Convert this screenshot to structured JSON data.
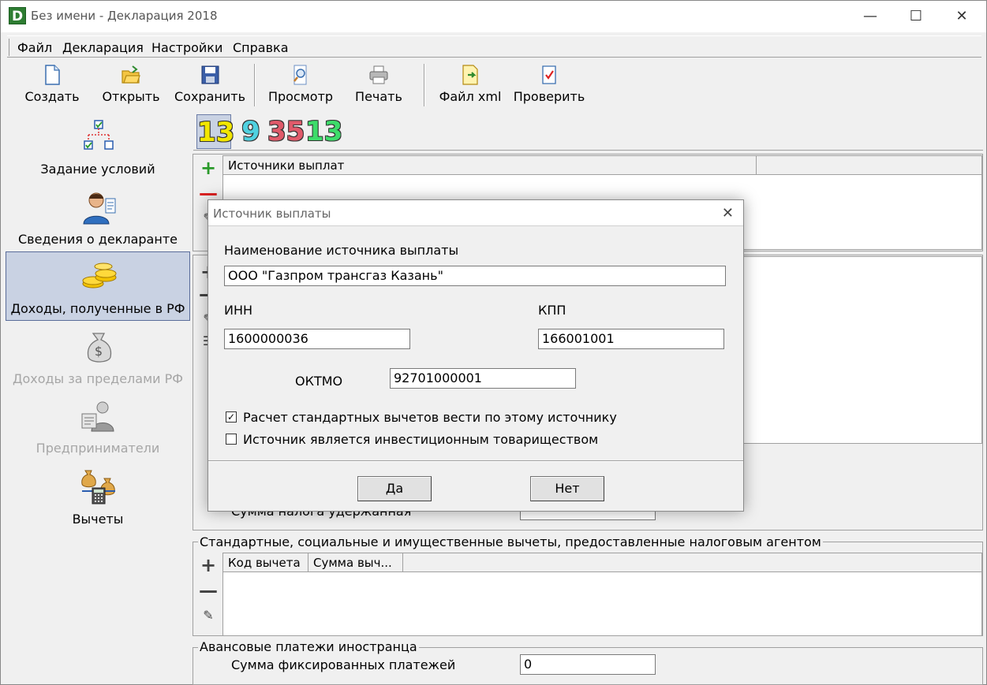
{
  "window": {
    "title": "Без имени - Декларация 2018",
    "app_icon": "D"
  },
  "menu": [
    "Файл",
    "Декларация",
    "Настройки",
    "Справка"
  ],
  "toolbar": {
    "create": "Создать",
    "open": "Открыть",
    "save": "Сохранить",
    "preview": "Просмотр",
    "print": "Печать",
    "xml": "Файл xml",
    "check": "Проверить"
  },
  "nav": [
    {
      "label": "Задание условий",
      "icon": "tree-checkbox-icon",
      "state": "normal"
    },
    {
      "label": "Сведения о декларанте",
      "icon": "person-icon",
      "state": "normal"
    },
    {
      "label": "Доходы, полученные в РФ",
      "icon": "coins-icon",
      "state": "active"
    },
    {
      "label": "Доходы за пределами РФ",
      "icon": "money-bag-icon",
      "state": "disabled"
    },
    {
      "label": "Предприниматели",
      "icon": "businessman-icon",
      "state": "disabled"
    },
    {
      "label": "Вычеты",
      "icon": "calculator-bags-icon",
      "state": "normal"
    }
  ],
  "rate_tabs": [
    {
      "label": "13",
      "color": "#f2e600",
      "selected": true
    },
    {
      "label": "9",
      "color": "#4fd1e0",
      "selected": false
    },
    {
      "label": "35",
      "color": "#e05a6a",
      "selected": false
    },
    {
      "label": "13",
      "color": "#3ddc6a",
      "selected": false
    }
  ],
  "sources_grid": {
    "header": "Источники выплат"
  },
  "tax_withheld_label": "Сумма налога удержанная",
  "deductions_group": {
    "title": "Стандартные, социальные и имущественные вычеты, предоставленные налоговым агентом",
    "col1": "Код вычета",
    "col2": "Сумма выч..."
  },
  "advance_group": {
    "title": "Авансовые платежи иностранца",
    "label": "Сумма фиксированных платежей",
    "value": "0"
  },
  "dialog": {
    "title": "Источник выплаты",
    "name_label": "Наименование источника выплаты",
    "name_value": "ООО \"Газпром трансгаз Казань\"",
    "inn_label": "ИНН",
    "inn_value": "1600000036",
    "kpp_label": "КПП",
    "kpp_value": "166001001",
    "oktmo_label": "ОКТМО",
    "oktmo_value": "92701000001",
    "chk1_label": "Расчет стандартных вычетов вести по этому источнику",
    "chk1_checked": true,
    "chk2_label": "Источник является инвестиционным товариществом",
    "chk2_checked": false,
    "ok": "Да",
    "cancel": "Нет"
  }
}
